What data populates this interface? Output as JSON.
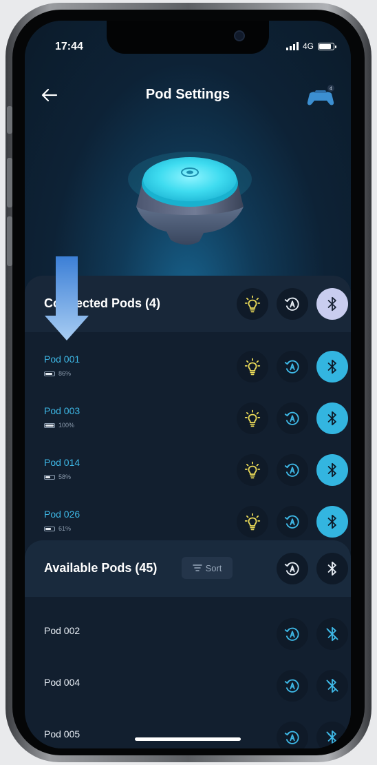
{
  "status_bar": {
    "time": "17:44",
    "network": "4G"
  },
  "header": {
    "title": "Pod Settings"
  },
  "connected": {
    "title": "Connected Pods (4)",
    "pods": [
      {
        "name": "Pod 001",
        "battery": "86%",
        "level": 0.86
      },
      {
        "name": "Pod 003",
        "battery": "100%",
        "level": 1.0
      },
      {
        "name": "Pod 014",
        "battery": "58%",
        "level": 0.58
      },
      {
        "name": "Pod 026",
        "battery": "61%",
        "level": 0.61
      }
    ]
  },
  "available": {
    "title": "Available Pods (45)",
    "sort_label": "Sort",
    "pods": [
      {
        "name": "Pod 002"
      },
      {
        "name": "Pod 004"
      },
      {
        "name": "Pod 005"
      }
    ]
  },
  "colors": {
    "accent": "#33b5e0",
    "background": "#0e1c2a",
    "bluetooth_head": "#c9cdef"
  },
  "icons": [
    "back-arrow-icon",
    "gamepad-icon",
    "lightbulb-icon",
    "auto-rotate-icon",
    "bluetooth-icon",
    "bluetooth-disabled-icon",
    "filter-icon"
  ]
}
